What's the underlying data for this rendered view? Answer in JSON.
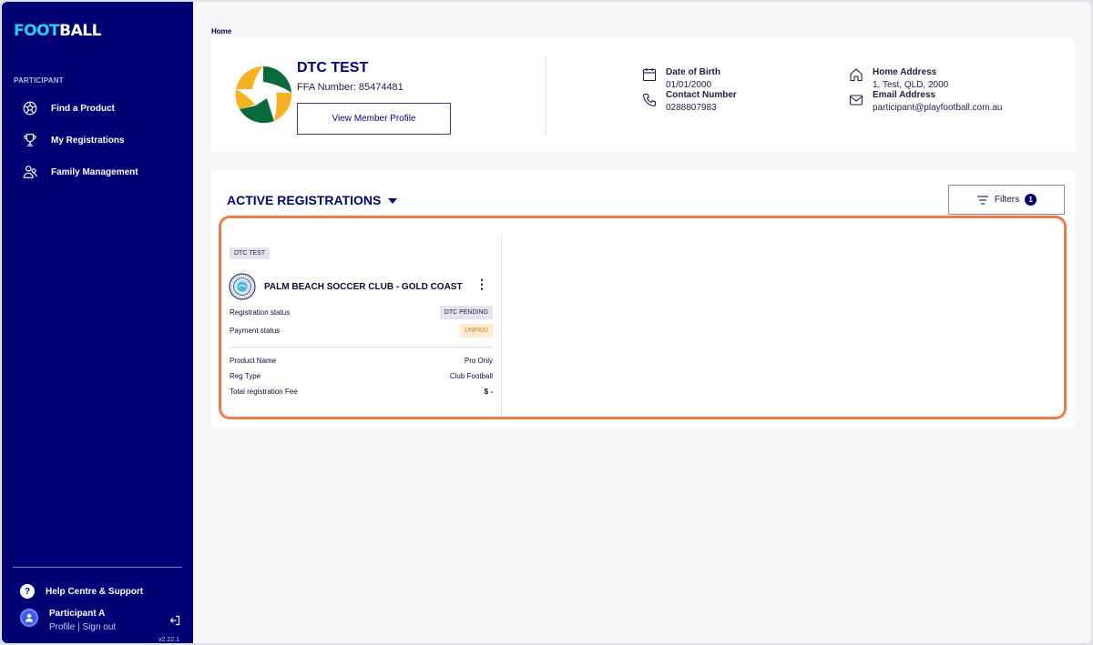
{
  "sidebar": {
    "logo": {
      "part1": "FOOT",
      "part2": "BALL"
    },
    "section_label": "PARTICIPANT",
    "items": [
      {
        "label": "Find a Product",
        "icon": "soccer-ball-icon"
      },
      {
        "label": "My Registrations",
        "icon": "trophy-icon"
      },
      {
        "label": "Family Management",
        "icon": "family-icon"
      }
    ],
    "help_label": "Help Centre & Support",
    "help_icon_text": "?",
    "user": {
      "name": "Participant A",
      "links": "Profile | Sign out"
    },
    "version": "v2.22.1"
  },
  "breadcrumb": "Home",
  "profile": {
    "name": "DTC TEST",
    "ffa_number": "FFA Number: 85474481",
    "view_button": "View Member Profile",
    "dob_label": "Date of Birth",
    "dob_value": "01/01/2000",
    "contact_label": "Contact Number",
    "contact_value": "0288807983",
    "address_label": "Home Address",
    "address_value": "1, Test, QLD, 2000",
    "email_label": "Email Address",
    "email_value": "participant@playfootball.com.au"
  },
  "registrations": {
    "title": "ACTIVE REGISTRATIONS",
    "filters_label": "Filters",
    "filters_count": "1",
    "item": {
      "tag": "DTC TEST",
      "club_name": "PALM BEACH SOCCER CLUB - GOLD COAST",
      "reg_status_label": "Registration status",
      "reg_status_value": "DTC PENDING",
      "payment_status_label": "Payment status",
      "payment_status_value": "UNPAID",
      "product_name_label": "Product Name",
      "product_name_value": "Pro Only",
      "reg_type_label": "Reg Type",
      "reg_type_value": "Club Football",
      "fee_label": "Total registration Fee",
      "fee_value": "$ -"
    }
  },
  "colors": {
    "sidebar_bg": "#000075",
    "logo_accent": "#20d5ec",
    "highlight": "#ef7b4a",
    "unpaid_bg": "#fdecd2",
    "unpaid_text": "#d17a2a"
  }
}
